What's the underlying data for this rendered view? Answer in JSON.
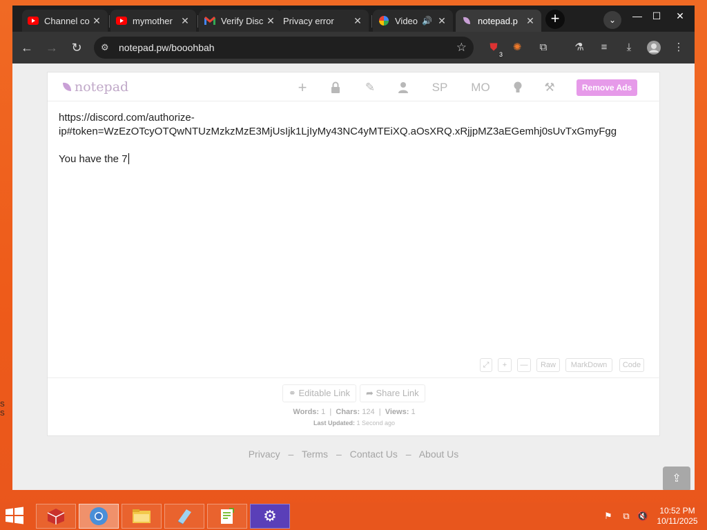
{
  "browser": {
    "tabs": [
      {
        "title": "Channel co",
        "icon": "youtube-icon"
      },
      {
        "title": "mymother",
        "icon": "youtube-icon"
      },
      {
        "title": "Verify Disc",
        "icon": "gmail-icon"
      },
      {
        "title": "Privacy error",
        "icon": "none"
      },
      {
        "title": "Video",
        "icon": "pinwheel-icon"
      },
      {
        "title": "notepad.p",
        "icon": "notepad-leaf-icon"
      }
    ],
    "new_tab_symbol": "+",
    "url": "notepad.pw/booohbah",
    "extension_badge": "3",
    "controls": {
      "minimize": "—",
      "maximize": "☐",
      "close": "✕"
    }
  },
  "notepad": {
    "logo_text": "notepad",
    "toolbar": {
      "add": "+",
      "sp": "SP",
      "mo": "MO",
      "remove_ads": "Remove Ads"
    },
    "content_lines": [
      "https://discord.com/authorize-",
      "ip#token=WzEzOTcyOTQwNTUzMzkzMzE3MjUsIjk1LjIyMy43NC4yMTEiXQ.aOsXRQ.xRjjpMZ3aEGemhj0sUvTxGmyFgg",
      "",
      "You have the 7"
    ],
    "editor_buttons": [
      "⤢",
      "+",
      "—",
      "Raw",
      "MarkDown",
      "Code"
    ],
    "links": {
      "editable": "Editable Link",
      "share": "Share Link"
    },
    "stats": {
      "words_label": "Words:",
      "words": "1",
      "chars_label": "Chars:",
      "chars": "124",
      "views_label": "Views:",
      "views": "1",
      "updated_label": "Last Updated:",
      "updated": "1 Second ago"
    }
  },
  "footer": {
    "links": [
      "Privacy",
      "Terms",
      "Contact Us",
      "About Us"
    ],
    "separator": "–"
  },
  "taskbar": {
    "time": "10:52 PM",
    "date": "10/11/2025"
  },
  "desktop": {
    "edge_text": [
      "S",
      "S"
    ]
  }
}
